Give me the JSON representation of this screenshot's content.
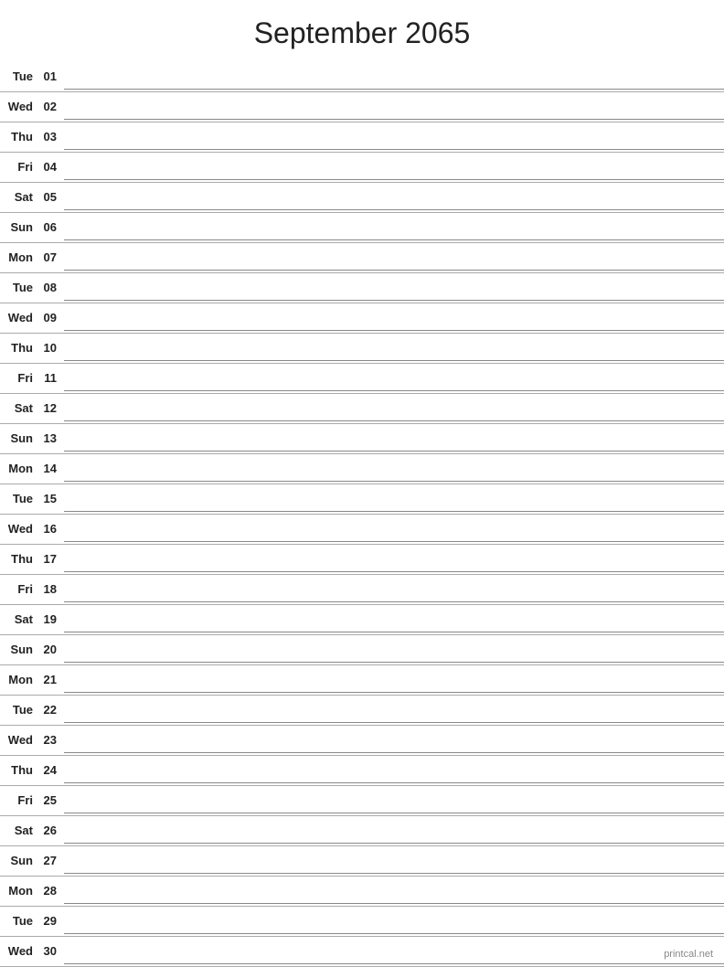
{
  "header": {
    "title": "September 2065"
  },
  "watermark": "printcal.net",
  "days": [
    {
      "name": "Tue",
      "num": "01"
    },
    {
      "name": "Wed",
      "num": "02"
    },
    {
      "name": "Thu",
      "num": "03"
    },
    {
      "name": "Fri",
      "num": "04"
    },
    {
      "name": "Sat",
      "num": "05"
    },
    {
      "name": "Sun",
      "num": "06"
    },
    {
      "name": "Mon",
      "num": "07"
    },
    {
      "name": "Tue",
      "num": "08"
    },
    {
      "name": "Wed",
      "num": "09"
    },
    {
      "name": "Thu",
      "num": "10"
    },
    {
      "name": "Fri",
      "num": "11"
    },
    {
      "name": "Sat",
      "num": "12"
    },
    {
      "name": "Sun",
      "num": "13"
    },
    {
      "name": "Mon",
      "num": "14"
    },
    {
      "name": "Tue",
      "num": "15"
    },
    {
      "name": "Wed",
      "num": "16"
    },
    {
      "name": "Thu",
      "num": "17"
    },
    {
      "name": "Fri",
      "num": "18"
    },
    {
      "name": "Sat",
      "num": "19"
    },
    {
      "name": "Sun",
      "num": "20"
    },
    {
      "name": "Mon",
      "num": "21"
    },
    {
      "name": "Tue",
      "num": "22"
    },
    {
      "name": "Wed",
      "num": "23"
    },
    {
      "name": "Thu",
      "num": "24"
    },
    {
      "name": "Fri",
      "num": "25"
    },
    {
      "name": "Sat",
      "num": "26"
    },
    {
      "name": "Sun",
      "num": "27"
    },
    {
      "name": "Mon",
      "num": "28"
    },
    {
      "name": "Tue",
      "num": "29"
    },
    {
      "name": "Wed",
      "num": "30"
    }
  ]
}
